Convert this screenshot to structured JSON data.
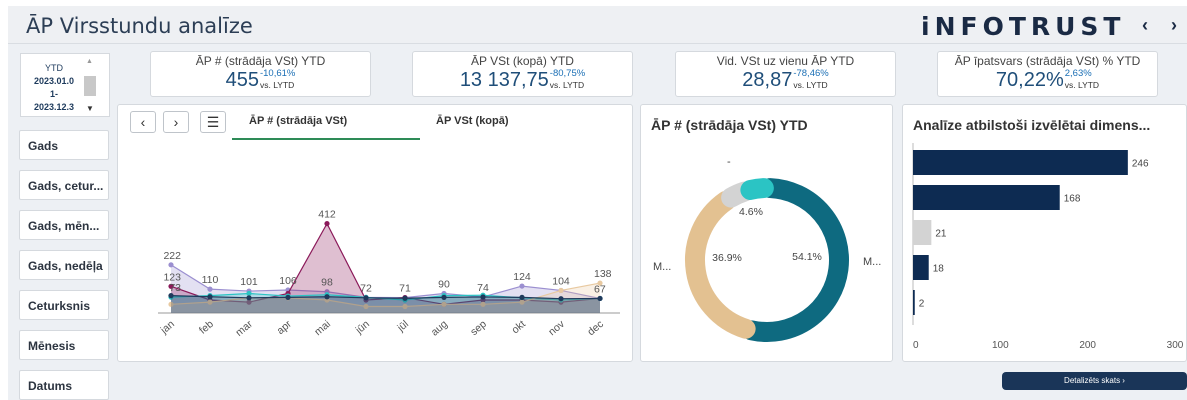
{
  "header": {
    "title": "ĀP Virsstundu analīze",
    "brand": "iNFOTRUST",
    "prev_label": "‹",
    "next_label": "›"
  },
  "period": {
    "label": "YTD",
    "start": "2023.01.0",
    "dash": "1-",
    "end": "2023.12.3"
  },
  "filters": [
    "Gads",
    "Gads, cetur...",
    "Gads, mēn...",
    "Gads, nedēļa",
    "Ceturksnis",
    "Mēnesis",
    "Datums"
  ],
  "kpis": [
    {
      "title": "ĀP # (strādāja VSt) YTD",
      "value": "455",
      "change": "-10,61%",
      "vs": "vs. LYTD"
    },
    {
      "title": "ĀP VSt (kopā) YTD",
      "value": "13 137,75",
      "change": "-80,75%",
      "vs": "vs. LYTD"
    },
    {
      "title": "Vid. VSt uz vienu ĀP YTD",
      "value": "28,87",
      "change": "-78,46%",
      "vs": "vs. LYTD"
    },
    {
      "title": "ĀP īpatsvars (strādāja VSt) % YTD",
      "value": "70,22%",
      "change": "2,63%",
      "vs": "vs. LYTD"
    }
  ],
  "line_panel": {
    "prev_icon": "‹",
    "next_icon": "›",
    "list_icon": "☰",
    "tabs": [
      "ĀP # (strādāja VSt)",
      "ĀP VSt (kopā)"
    ]
  },
  "donut_panel": {
    "title": "ĀP # (strādāja VSt) YTD"
  },
  "bar_panel": {
    "title": "Analīze atbilstoši izvēlētai dimens..."
  },
  "detail_button": "Detalizēts skats ›",
  "chart_data": [
    {
      "type": "area",
      "categories": [
        "jan",
        "feb",
        "mar",
        "apr",
        "mai",
        "jūn",
        "jūl",
        "aug",
        "sep",
        "okt",
        "nov",
        "dec"
      ],
      "series": [
        {
          "color": "#9b8fd0",
          "values": [
            222,
            110,
            101,
            106,
            98,
            72,
            71,
            90,
            74,
            124,
            104,
            67
          ]
        },
        {
          "color": "#8b1a5a",
          "values": [
            123,
            60,
            50,
            90,
            412,
            60,
            71,
            40,
            60,
            60,
            50,
            67
          ]
        },
        {
          "color": "#2bc4c4",
          "values": [
            73,
            80,
            90,
            78,
            84,
            72,
            60,
            80,
            82,
            70,
            60,
            67
          ]
        },
        {
          "color": "#e8c9a0",
          "values": [
            40,
            50,
            70,
            70,
            60,
            30,
            30,
            40,
            40,
            50,
            104,
            138
          ]
        },
        {
          "color": "#1f3a5c",
          "values": [
            80,
            75,
            70,
            72,
            75,
            70,
            68,
            72,
            74,
            72,
            66,
            67
          ]
        }
      ],
      "point_labels": [
        {
          "index": 0,
          "text": "222",
          "value": 222
        },
        {
          "index": 0,
          "text": "123",
          "value": 123
        },
        {
          "index": 0,
          "text": "73",
          "value": 73
        },
        {
          "index": 1,
          "text": "110",
          "value": 110
        },
        {
          "index": 2,
          "text": "101",
          "value": 101
        },
        {
          "index": 3,
          "text": "106",
          "value": 106
        },
        {
          "index": 4,
          "text": "412",
          "value": 412
        },
        {
          "index": 4,
          "text": "98",
          "value": 98
        },
        {
          "index": 5,
          "text": "72",
          "value": 72
        },
        {
          "index": 6,
          "text": "71",
          "value": 71
        },
        {
          "index": 7,
          "text": "90",
          "value": 90
        },
        {
          "index": 8,
          "text": "74",
          "value": 74
        },
        {
          "index": 9,
          "text": "124",
          "value": 124
        },
        {
          "index": 10,
          "text": "104",
          "value": 104
        },
        {
          "index": 11,
          "text": "138",
          "value": 138
        },
        {
          "index": 11,
          "text": "67",
          "value": 67
        }
      ],
      "ylim": [
        0,
        412
      ]
    },
    {
      "type": "pie",
      "slices": [
        {
          "label": "M...",
          "pct_label": "54.1%",
          "value": 54.1,
          "color": "#0e6a80"
        },
        {
          "label": "M...",
          "pct_label": "36.9%",
          "value": 36.9,
          "color": "#e3c191"
        },
        {
          "label": "",
          "pct_label": "4.6%",
          "value": 4.6,
          "color": "#d3d3d3"
        },
        {
          "label": "-",
          "pct_label": "",
          "value": 4.4,
          "color": "#2bc4c4"
        }
      ]
    },
    {
      "type": "bar",
      "orientation": "horizontal",
      "values": [
        246,
        168,
        21,
        18,
        2
      ],
      "colors": [
        "#0d2b52",
        "#0d2b52",
        "#d3d3d3",
        "#0d2b52",
        "#0d2b52"
      ],
      "xticks": [
        "0",
        "100",
        "200",
        "300"
      ],
      "xlim": [
        0,
        300
      ]
    }
  ]
}
